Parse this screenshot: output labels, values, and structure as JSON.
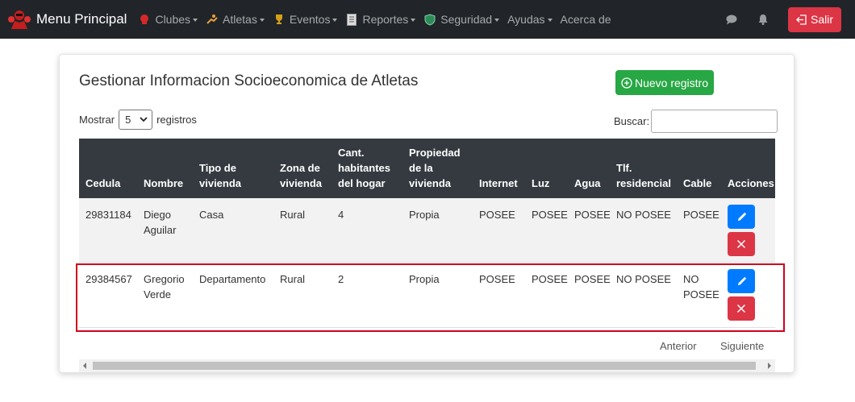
{
  "navbar": {
    "brand": "Menu Principal",
    "items": [
      {
        "label": "Clubes",
        "icon": "boxing-glove-icon",
        "dropdown": true
      },
      {
        "label": "Atletas",
        "icon": "athlete-icon",
        "dropdown": true
      },
      {
        "label": "Eventos",
        "icon": "trophy-icon",
        "dropdown": true
      },
      {
        "label": "Reportes",
        "icon": "report-icon",
        "dropdown": true
      },
      {
        "label": "Seguridad",
        "icon": "shield-icon",
        "dropdown": true
      },
      {
        "label": "Ayudas",
        "dropdown": true
      },
      {
        "label": "Acerca de",
        "dropdown": false
      }
    ],
    "logout_label": "Salir"
  },
  "page": {
    "title": "Gestionar Informacion Socioeconomica de Atletas",
    "new_button": "Nuevo registro",
    "show_label": "Mostrar",
    "show_value": "5",
    "records_label": "registros",
    "search_label": "Buscar:",
    "search_value": ""
  },
  "table": {
    "headers": {
      "cedula": "Cedula",
      "nombre": "Nombre",
      "tipo1": "Tipo de",
      "tipo2": "vivienda",
      "zona1": "Zona de",
      "zona2": "vivienda",
      "cant1": "Cant.",
      "cant2": "habitantes",
      "cant3": "del hogar",
      "prop1": "Propiedad",
      "prop2": "de la",
      "prop3": "vivienda",
      "internet": "Internet",
      "luz": "Luz",
      "agua": "Agua",
      "tlf1": "Tlf.",
      "tlf2": "residencial",
      "cable": "Cable",
      "acciones": "Acciones"
    },
    "rows": [
      {
        "cedula": "29831184",
        "nombre1": "Diego",
        "nombre2": "Aguilar",
        "tipo": "Casa",
        "zona": "Rural",
        "cant": "4",
        "propiedad": "Propia",
        "internet": "POSEE",
        "luz": "POSEE",
        "agua": "POSEE",
        "tlf": "NO POSEE",
        "cable1": "POSEE",
        "cable2": ""
      },
      {
        "cedula": "29384567",
        "nombre1": "Gregorio",
        "nombre2": "Verde",
        "tipo": "Departamento",
        "zona": "Rural",
        "cant": "2",
        "propiedad": "Propia",
        "internet": "POSEE",
        "luz": "POSEE",
        "agua": "POSEE",
        "tlf": "NO POSEE",
        "cable1": "NO",
        "cable2": "POSEE"
      }
    ]
  },
  "pagination": {
    "prev": "Anterior",
    "next": "Siguiente"
  },
  "colors": {
    "navbar": "#212529",
    "danger": "#dc3545",
    "success": "#28a745",
    "primary": "#007bff",
    "table_header": "#343a40",
    "highlight": "#d0021b"
  }
}
